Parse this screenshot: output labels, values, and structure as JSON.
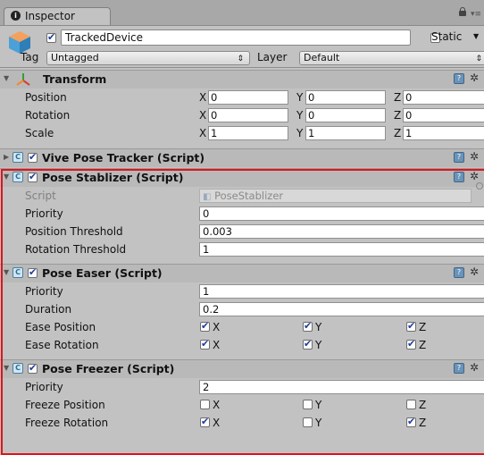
{
  "window": {
    "tab_label": "Inspector"
  },
  "gameobject": {
    "name": "TrackedDevice",
    "active": true,
    "static_label": "Static",
    "static": false,
    "tag_label": "Tag",
    "tag_value": "Untagged",
    "layer_label": "Layer",
    "layer_value": "Default"
  },
  "transform": {
    "title": "Transform",
    "rows": [
      {
        "label": "Position",
        "x": "0",
        "y": "0",
        "z": "0"
      },
      {
        "label": "Rotation",
        "x": "0",
        "y": "0",
        "z": "0"
      },
      {
        "label": "Scale",
        "x": "1",
        "y": "1",
        "z": "1"
      }
    ],
    "axis": {
      "x": "X",
      "y": "Y",
      "z": "Z"
    }
  },
  "vive_pose_tracker": {
    "title": "Vive Pose Tracker (Script)",
    "enabled": true,
    "collapsed": true
  },
  "pose_stablizer": {
    "title": "Pose Stablizer (Script)",
    "enabled": true,
    "script_label": "Script",
    "script_value": "PoseStablizer",
    "priority_label": "Priority",
    "priority_value": "0",
    "pos_thresh_label": "Position Threshold",
    "pos_thresh_value": "0.003",
    "rot_thresh_label": "Rotation Threshold",
    "rot_thresh_value": "1"
  },
  "pose_easer": {
    "title": "Pose Easer (Script)",
    "enabled": true,
    "priority_label": "Priority",
    "priority_value": "1",
    "duration_label": "Duration",
    "duration_value": "0.2",
    "ease_position_label": "Ease Position",
    "ease_position": {
      "x": true,
      "y": true,
      "z": true
    },
    "ease_rotation_label": "Ease Rotation",
    "ease_rotation": {
      "x": true,
      "y": true,
      "z": true
    }
  },
  "pose_freezer": {
    "title": "Pose Freezer (Script)",
    "enabled": true,
    "priority_label": "Priority",
    "priority_value": "2",
    "freeze_position_label": "Freeze Position",
    "freeze_position": {
      "x": false,
      "y": false,
      "z": false
    },
    "freeze_rotation_label": "Freeze Rotation",
    "freeze_rotation": {
      "x": true,
      "y": false,
      "z": true
    }
  },
  "axis_labels": {
    "x": "X",
    "y": "Y",
    "z": "Z"
  },
  "colors": {
    "highlight": "#e0141b",
    "checkmark": "#1e3f99"
  }
}
